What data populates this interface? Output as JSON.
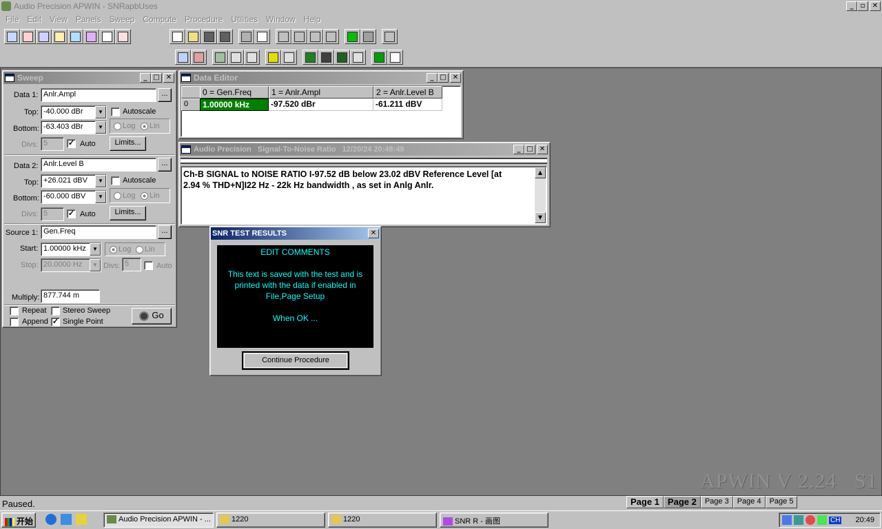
{
  "app": {
    "title": "Audio Precision APWIN - SNRapbUses",
    "watermark": "APWIN V 2.24   S1",
    "status": "Paused."
  },
  "menu": [
    "File",
    "Edit",
    "View",
    "Panels",
    "Sweep",
    "Compute",
    "Procedure",
    "Utilities",
    "Window",
    "Help"
  ],
  "toolbar": {
    "row1_left": [
      "AC",
      "THD",
      "SNR",
      "FFT",
      "BAR",
      "MLS",
      "✓",
      "≡"
    ],
    "row1_right": [
      "new",
      "open",
      "save",
      "saveall",
      "print",
      "preview",
      "undo",
      "cut",
      "copy",
      "paste",
      "run",
      "stop",
      "meter"
    ],
    "row2": [
      "gen",
      "anlr",
      "dcx",
      "io",
      "stat",
      "dcx2",
      "sw",
      "lim",
      "grph",
      "tbl",
      "bar",
      "sheet",
      "edit"
    ]
  },
  "sweep": {
    "title": "Sweep",
    "data1_label": "Data 1:",
    "data1_value": "Anlr.Ampl",
    "top_label": "Top:",
    "data1_top": "-40.000  dBr",
    "bottom_label": "Bottom:",
    "data1_bottom": "-63.403  dBr",
    "autoscale": "Autoscale",
    "log": "Log",
    "lin": "Lin",
    "divs_label": "Divs:",
    "divs_value": "5",
    "auto": "Auto",
    "limits": "Limits...",
    "data2_label": "Data 2:",
    "data2_value": "Anlr.Level B",
    "data2_top": "+26.021  dBV",
    "data2_bottom": "-60.000  dBV",
    "source1_label": "Source 1:",
    "source1_value": "Gen.Freq",
    "start_label": "Start:",
    "start_value": "1.00000 kHz",
    "stop_label": "Stop:",
    "stop_value": "20.0000  Hz",
    "divs2_value": "5",
    "multiply_label": "Multiply:",
    "multiply_value": "877.744 m",
    "repeat": "Repeat",
    "stereo": "Stereo Sweep",
    "append": "Append",
    "single_point": "Single Point",
    "go": "Go",
    "ellipsis": "..."
  },
  "data_editor": {
    "title": "Data Editor",
    "columns": [
      "0 = Gen.Freq",
      "1 = Anlr.Ampl",
      "2 = Anlr.Level B"
    ],
    "row_index": "0",
    "row": [
      "1.00000 kHz",
      "-97.520  dBr",
      "-61.211  dBV"
    ]
  },
  "snr_window": {
    "title": "Audio Precision   Signal-To-Noise Ratio   12/20/24 20:48:49",
    "text_line1": "Ch-B SIGNAL to NOISE RATIO I-97.52 dB below 23.02 dBV  Reference Level [at",
    "text_line2": "2.94 %  THD+N]I22 Hz - 22k Hz bandwidth , as set in Anlg Anlr."
  },
  "dialog": {
    "title": "SNR TEST RESULTS",
    "heading": "EDIT COMMENTS",
    "line1": "This text is saved with the test and is",
    "line2": "printed with the data if enabled in",
    "line3": "File,Page Setup",
    "line4": "When OK ...",
    "button": "Continue Procedure"
  },
  "pages": [
    "Page 1",
    "Page 2",
    "Page 3",
    "Page 4",
    "Page 5"
  ],
  "taskbar": {
    "start": "开始",
    "items": [
      "Audio Precision APWIN - ...",
      "1220",
      "1220",
      "SNR R - 画图"
    ],
    "lang": "CH",
    "clock": "20:49"
  },
  "colors": {
    "accent": "#0a246a",
    "highlight_cell": "#008000",
    "dialog_bg": "#000000",
    "dialog_text": "#00ffff"
  }
}
